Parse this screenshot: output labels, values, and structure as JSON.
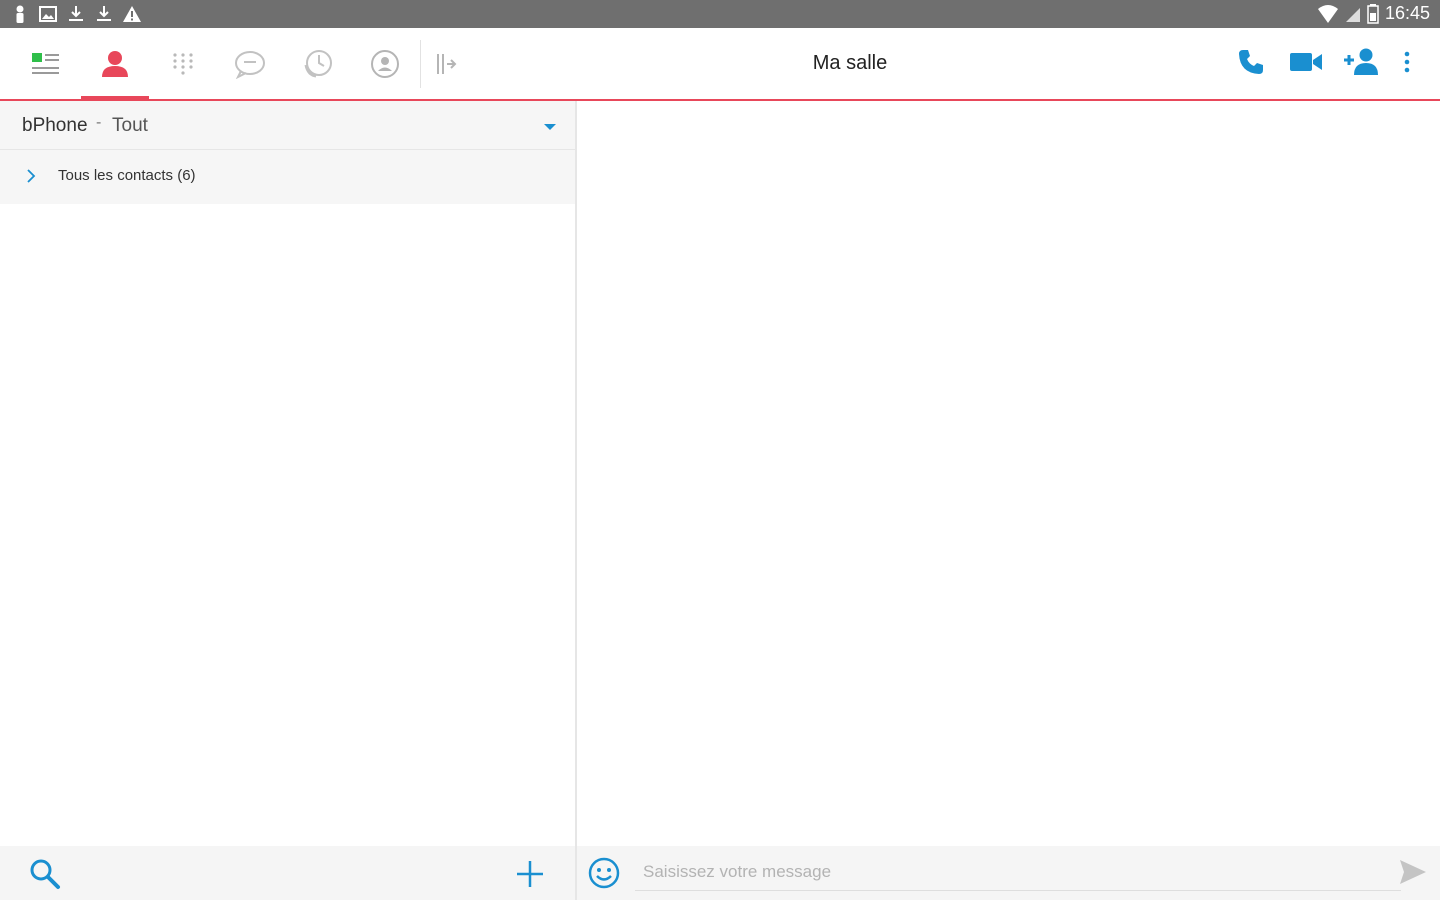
{
  "status_bar": {
    "time": "16:45",
    "left_icons": [
      "person-icon",
      "image-icon",
      "download-icon",
      "download-icon",
      "warning-icon"
    ],
    "right_icons": [
      "wifi-icon",
      "signal-icon",
      "battery-icon"
    ]
  },
  "toolbar": {
    "title": "Ma salle",
    "tabs": [
      {
        "icon": "dashboard-icon",
        "active": false
      },
      {
        "icon": "contacts-icon",
        "active": true
      },
      {
        "icon": "dialpad-icon",
        "active": false
      },
      {
        "icon": "chat-icon",
        "active": false
      },
      {
        "icon": "call-history-icon",
        "active": false
      },
      {
        "icon": "profile-icon",
        "active": false
      },
      {
        "icon": "collapse-panel-icon",
        "active": false
      }
    ],
    "actions": [
      "phone-call-icon",
      "video-call-icon",
      "add-participant-icon",
      "more-options-icon"
    ]
  },
  "contacts_panel": {
    "account": "bPhone",
    "separator": "-",
    "filter": "Tout",
    "groups": [
      {
        "label": "Tous les contacts (6)"
      }
    ]
  },
  "chat": {
    "input_placeholder": "Saisissez votre message",
    "input_value": ""
  },
  "colors": {
    "accent_red": "#e8475a",
    "accent_blue": "#1a8fd0",
    "accent_green": "#2fbf4a",
    "status_bar": "#6f6f6f"
  }
}
